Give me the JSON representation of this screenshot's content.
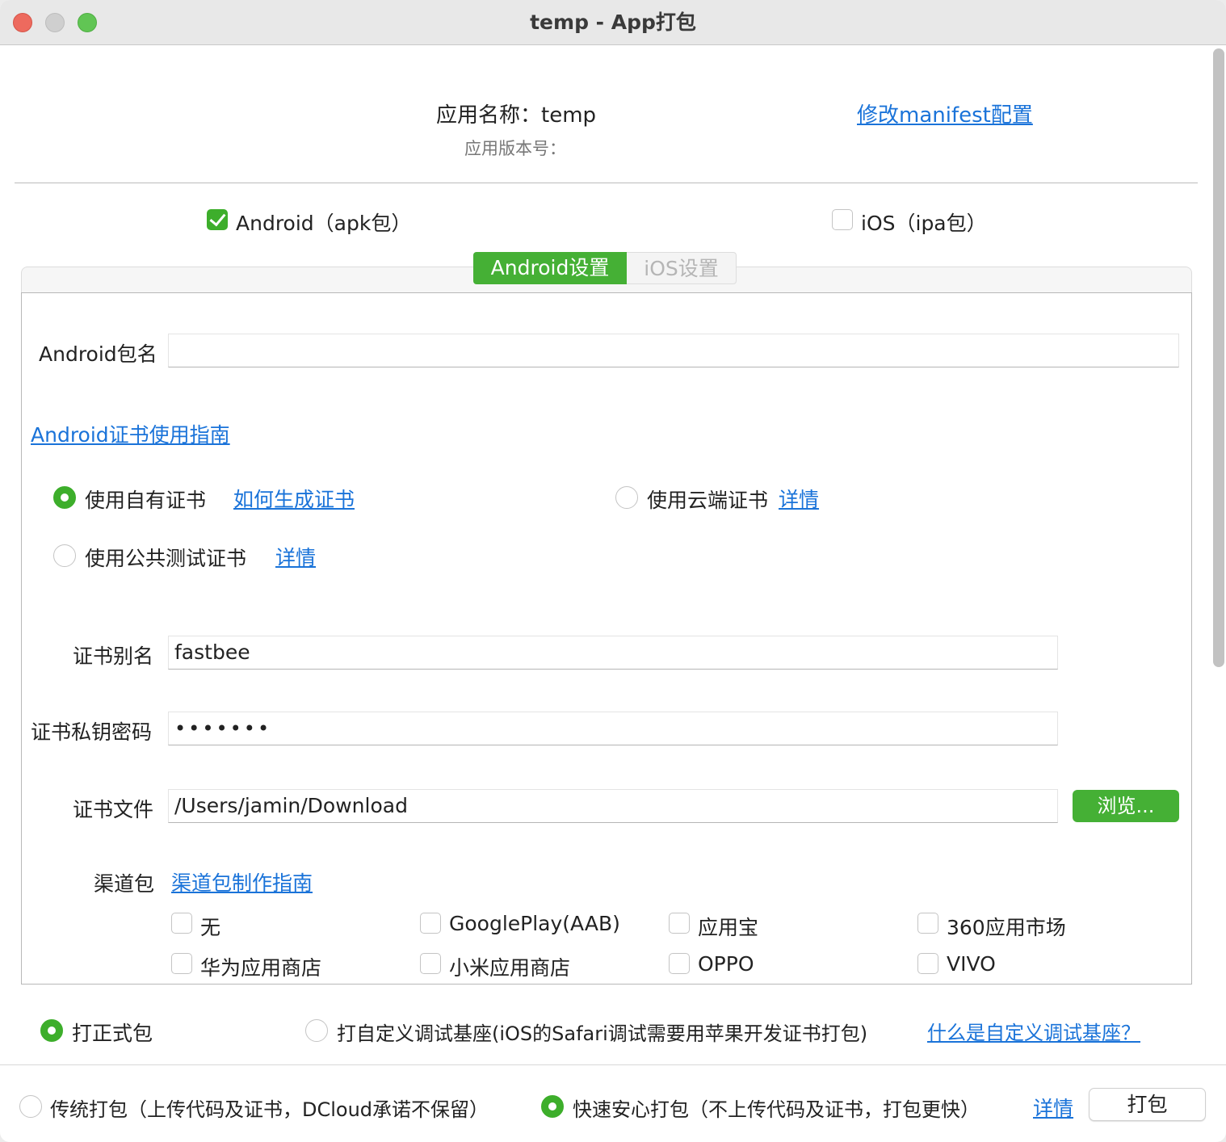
{
  "window": {
    "title": "temp - App打包"
  },
  "header": {
    "app_name": "应用名称：temp",
    "app_version": "应用版本号：",
    "manifest_link": "修改manifest配置"
  },
  "platforms": {
    "android": {
      "label": "Android（apk包）",
      "checked": true
    },
    "ios": {
      "label": "iOS（ipa包）",
      "checked": false
    }
  },
  "tabs": [
    {
      "label": "Android设置",
      "active": true
    },
    {
      "label": "iOS设置",
      "active": false
    }
  ],
  "android": {
    "package_label": "Android包名",
    "package_value": "",
    "cert_guide_link": "Android证书使用指南",
    "cert_options": {
      "own": {
        "label": "使用自有证书",
        "link": "如何生成证书",
        "selected": true
      },
      "cloud": {
        "label": "使用云端证书",
        "link": "详情",
        "selected": false
      },
      "public_test": {
        "label": "使用公共测试证书",
        "link": "详情",
        "selected": false
      }
    },
    "alias_label": "证书别名",
    "alias_value": "fastbee",
    "password_label": "证书私钥密码",
    "password_value": "•••••••",
    "file_label": "证书文件",
    "file_value": "/Users/jamin/Download",
    "browse_button": "浏览...",
    "channel_label": "渠道包",
    "channel_link": "渠道包制作指南",
    "channels": [
      {
        "label": "无",
        "checked": false
      },
      {
        "label": "GooglePlay(AAB)",
        "checked": false
      },
      {
        "label": "应用宝",
        "checked": false
      },
      {
        "label": "360应用市场",
        "checked": false
      },
      {
        "label": "华为应用商店",
        "checked": false
      },
      {
        "label": "小米应用商店",
        "checked": false
      },
      {
        "label": "OPPO",
        "checked": false
      },
      {
        "label": "VIVO",
        "checked": false
      }
    ]
  },
  "build_type": {
    "release": {
      "label": "打正式包",
      "selected": true
    },
    "custom_base": {
      "label": "打自定义调试基座(iOS的Safari调试需要用苹果开发证书打包)",
      "selected": false
    },
    "custom_base_link": "什么是自定义调试基座？"
  },
  "pack_mode": {
    "traditional": {
      "label": "传统打包（上传代码及证书，DCloud承诺不保留）",
      "selected": false
    },
    "fast": {
      "label": "快速安心打包（不上传代码及证书，打包更快）",
      "selected": true
    },
    "details_link": "详情",
    "pack_button": "打包"
  },
  "colors": {
    "accent": "#45b035",
    "link": "#1a73d9"
  }
}
